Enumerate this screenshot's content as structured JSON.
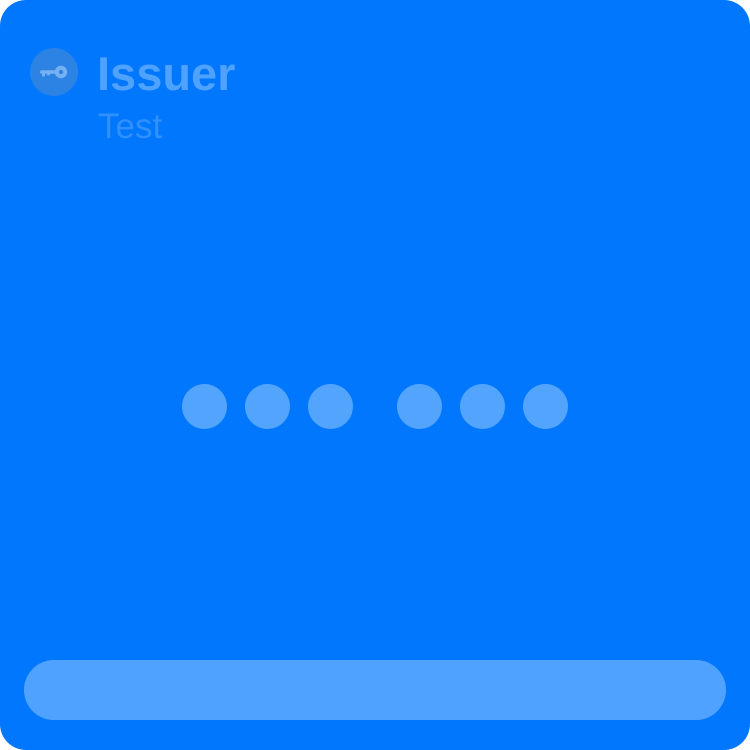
{
  "card": {
    "background": "#0077fd",
    "icon": "key-icon",
    "issuer": "Issuer",
    "account": "Test"
  },
  "code": {
    "groups": [
      {
        "digits": [
          "dot",
          "dot",
          "dot"
        ]
      },
      {
        "digits": [
          "dot",
          "dot",
          "dot"
        ]
      }
    ],
    "dot_color": "#53a4fd"
  },
  "progress": {
    "fraction": 1.0,
    "color": "#4fa2ff"
  }
}
